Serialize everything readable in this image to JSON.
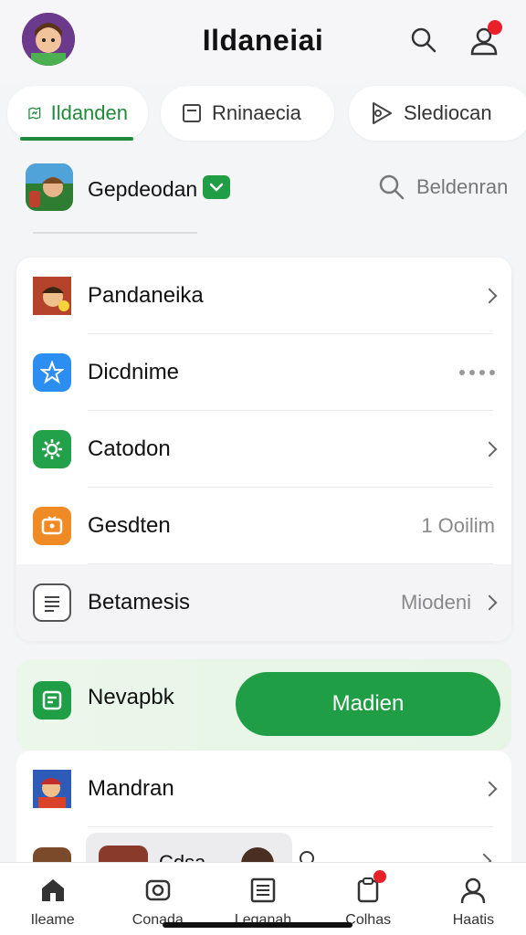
{
  "header": {
    "title": "Ildaneiai",
    "has_notification": true
  },
  "tabs": [
    {
      "label": "Ildanden",
      "icon": "map-icon",
      "active": true
    },
    {
      "label": "Rninaecia",
      "icon": "square-icon",
      "active": false
    },
    {
      "label": "Slediocan",
      "icon": "play-icon",
      "active": false
    }
  ],
  "profile": {
    "name": "Gepdeodan",
    "verified": true,
    "search_label": "Beldenran"
  },
  "list": [
    {
      "label": "Pandaneika",
      "icon": "game-character-icon",
      "value": "",
      "trail": "chevron"
    },
    {
      "label": "Dicdnime",
      "icon": "star-app-icon",
      "value": "",
      "trail": "dots"
    },
    {
      "label": "Catodon",
      "icon": "settings-gear-icon",
      "value": "",
      "trail": "chevron"
    },
    {
      "label": "Gesdten",
      "icon": "tv-icon",
      "value": "1 Ooilim",
      "trail": "none"
    },
    {
      "label": "Betamesis",
      "icon": "document-icon",
      "value": "Miodeni",
      "trail": "chevron"
    }
  ],
  "promo": {
    "label": "Nevapbk",
    "button": "Madien"
  },
  "secondary_list": [
    {
      "label": "Mandran",
      "icon": "game-hero-icon"
    }
  ],
  "partial_row": {
    "label": "Cdsa"
  },
  "nav": [
    {
      "label": "Ileame",
      "icon": "home-icon"
    },
    {
      "label": "Conada",
      "icon": "gamepad-icon"
    },
    {
      "label": "Leganah",
      "icon": "list-icon"
    },
    {
      "label": "Colhas",
      "icon": "clipboard-icon",
      "badge": true
    },
    {
      "label": "Haatis",
      "icon": "person-icon"
    }
  ],
  "colors": {
    "accent": "#1f9e45",
    "badge": "#e8202a"
  }
}
